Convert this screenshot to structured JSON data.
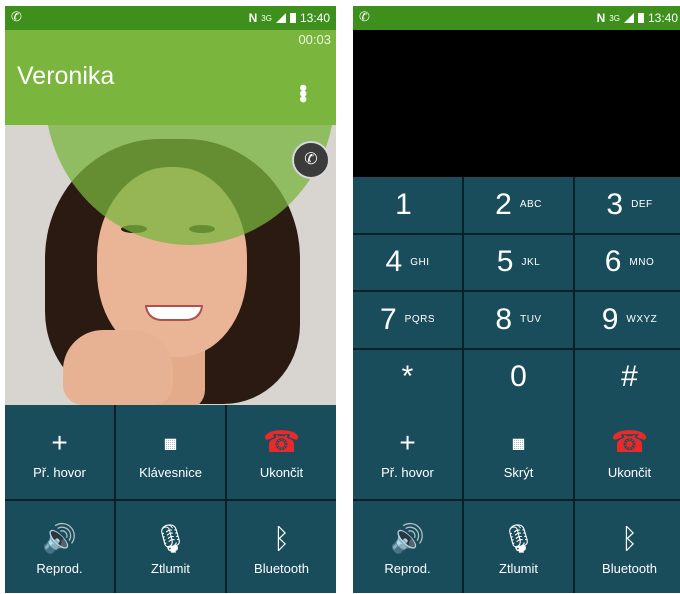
{
  "phone_in_call": {
    "status": {
      "time": "13:40",
      "network": "3G",
      "nfc": "N"
    },
    "call_timer": "00:03",
    "contact_name": "Veronika",
    "controls": [
      {
        "label": "Př. hovor",
        "icon": "plus-icon"
      },
      {
        "label": "Klávesnice",
        "icon": "keypad-icon"
      },
      {
        "label": "Ukončit",
        "icon": "end-call-icon"
      },
      {
        "label": "Reprod.",
        "icon": "speaker-icon"
      },
      {
        "label": "Ztlumit",
        "icon": "mute-mic-icon"
      },
      {
        "label": "Bluetooth",
        "icon": "bluetooth-icon"
      }
    ]
  },
  "phone_keypad": {
    "status": {
      "time": "13:40",
      "network": "3G",
      "nfc": "N"
    },
    "keys": [
      {
        "digit": "1",
        "letters": ""
      },
      {
        "digit": "2",
        "letters": "ABC"
      },
      {
        "digit": "3",
        "letters": "DEF"
      },
      {
        "digit": "4",
        "letters": "GHI"
      },
      {
        "digit": "5",
        "letters": "JKL"
      },
      {
        "digit": "6",
        "letters": "MNO"
      },
      {
        "digit": "7",
        "letters": "PQRS"
      },
      {
        "digit": "8",
        "letters": "TUV"
      },
      {
        "digit": "9",
        "letters": "WXYZ"
      },
      {
        "digit": "*",
        "letters": ""
      },
      {
        "digit": "0",
        "letters": ""
      },
      {
        "digit": "#",
        "letters": ""
      }
    ],
    "controls": [
      {
        "label": "Př. hovor",
        "icon": "plus-icon"
      },
      {
        "label": "Skrýt",
        "icon": "keypad-hide-icon"
      },
      {
        "label": "Ukončit",
        "icon": "end-call-icon"
      },
      {
        "label": "Reprod.",
        "icon": "speaker-icon"
      },
      {
        "label": "Ztlumit",
        "icon": "mute-mic-icon"
      },
      {
        "label": "Bluetooth",
        "icon": "bluetooth-icon"
      }
    ]
  },
  "colors": {
    "status_green": "#3f8f1c",
    "header_green": "#7ab53d",
    "tile": "#1a4d5c",
    "end_red": "#e82a2a"
  }
}
